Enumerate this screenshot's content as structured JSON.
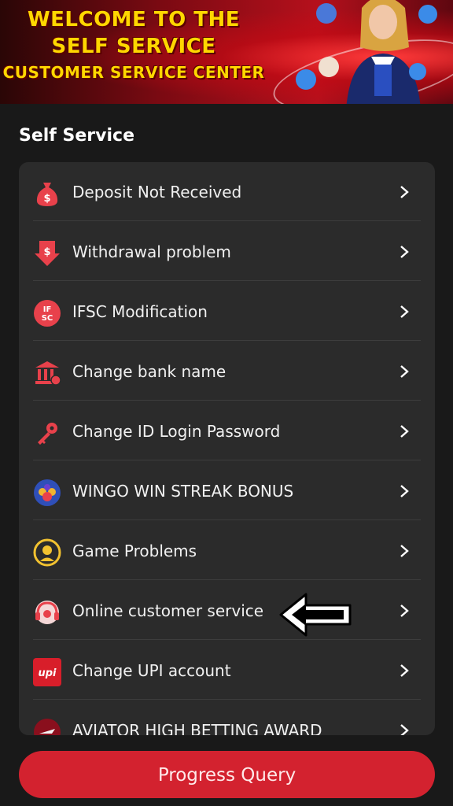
{
  "banner": {
    "line1": "WELCOME TO THE",
    "line2": "SELF SERVICE",
    "line3": "CUSTOMER SERVICE CENTER"
  },
  "section_title": "Self Service",
  "items": [
    {
      "label": "Deposit Not Received",
      "icon": "money-bag-icon"
    },
    {
      "label": "Withdrawal problem",
      "icon": "withdraw-arrow-icon"
    },
    {
      "label": "IFSC Modification",
      "icon": "ifsc-icon"
    },
    {
      "label": "Change bank name",
      "icon": "bank-icon"
    },
    {
      "label": "Change ID Login Password",
      "icon": "key-icon"
    },
    {
      "label": "WINGO WIN STREAK BONUS",
      "icon": "wingo-icon"
    },
    {
      "label": "Game Problems",
      "icon": "game-support-icon"
    },
    {
      "label": "Online customer service",
      "icon": "headset-icon"
    },
    {
      "label": "Change UPI account",
      "icon": "upi-icon"
    },
    {
      "label": "AVIATOR HIGH BETTING AWARD",
      "icon": "aviator-icon"
    }
  ],
  "upi_icon_text": "upi",
  "ifsc_icon_text": "IFSC",
  "progress_button": "Progress Query",
  "colors": {
    "accent": "#d3222f",
    "card": "#2b2b2b",
    "background": "#191919"
  }
}
